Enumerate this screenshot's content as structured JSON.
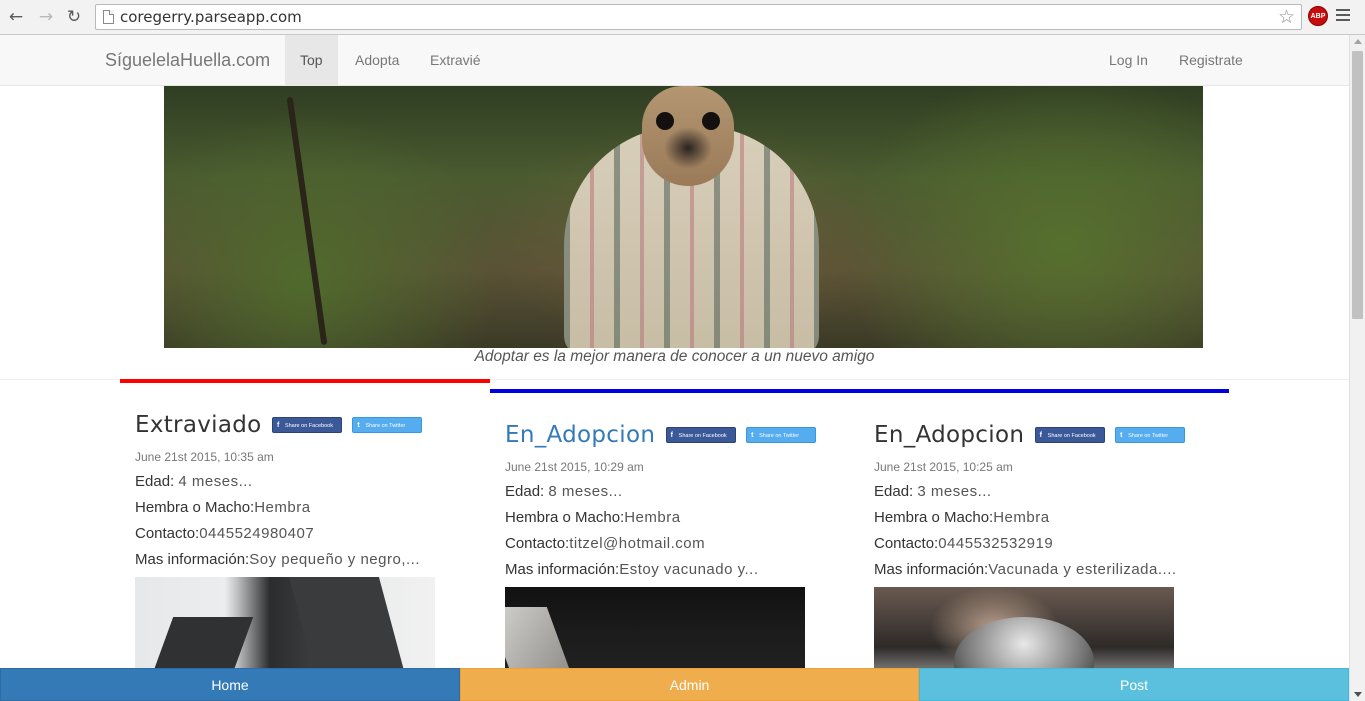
{
  "browser": {
    "url": "coregerry.parseapp.com",
    "back_icon": "arrow-left-icon",
    "forward_icon": "arrow-right-icon",
    "reload_icon": "reload-icon",
    "star_icon": "star-icon",
    "extension_label": "ABP"
  },
  "navbar": {
    "brand": "SíguelelaHuella.com",
    "links": [
      {
        "label": "Top",
        "active": true
      },
      {
        "label": "Adopta",
        "active": false
      },
      {
        "label": "Extravié",
        "active": false
      }
    ],
    "right_links": [
      {
        "label": "Log In"
      },
      {
        "label": "Registrate"
      }
    ]
  },
  "hero": {
    "caption": "Adoptar es la mejor manera de conocer a un nuevo amigo"
  },
  "share": {
    "facebook": "Share on Facebook",
    "twitter": "Share on Twitter",
    "facebook_glyph": "f",
    "twitter_glyph": "t"
  },
  "posts": [
    {
      "title": "Extraviado",
      "date": "June 21st 2015, 10:35 am",
      "edad_label": "Edad:",
      "edad": "4 meses...",
      "sexo_label": "Hembra o Macho:",
      "sexo": "Hembra",
      "contacto_label": "Contacto:",
      "contacto": "0445524980407",
      "info_label": "Mas información:",
      "info": "Soy pequeño y negro,..."
    },
    {
      "title": "En_Adopcion",
      "date": "June 21st 2015, 10:29 am",
      "edad_label": "Edad:",
      "edad": "8 meses...",
      "sexo_label": "Hembra o Macho:",
      "sexo": "Hembra",
      "contacto_label": "Contacto:",
      "contacto": "titzel@hotmail.com",
      "info_label": "Mas información:",
      "info": "Estoy vacunado y..."
    },
    {
      "title": "En_Adopcion",
      "date": "June 21st 2015, 10:25 am",
      "edad_label": "Edad:",
      "edad": "3 meses...",
      "sexo_label": "Hembra o Macho:",
      "sexo": "Hembra",
      "contacto_label": "Contacto:",
      "contacto": "0445532532919",
      "info_label": "Mas información:",
      "info": "Vacunada y esterilizada...."
    }
  ],
  "bottom": {
    "home": "Home",
    "admin": "Admin",
    "post": "Post"
  },
  "colors": {
    "red_bar": "#ff0000",
    "blue_bar": "#0000e0",
    "home": "#337ab7",
    "admin": "#f0ad4e",
    "post": "#5bc0de"
  }
}
